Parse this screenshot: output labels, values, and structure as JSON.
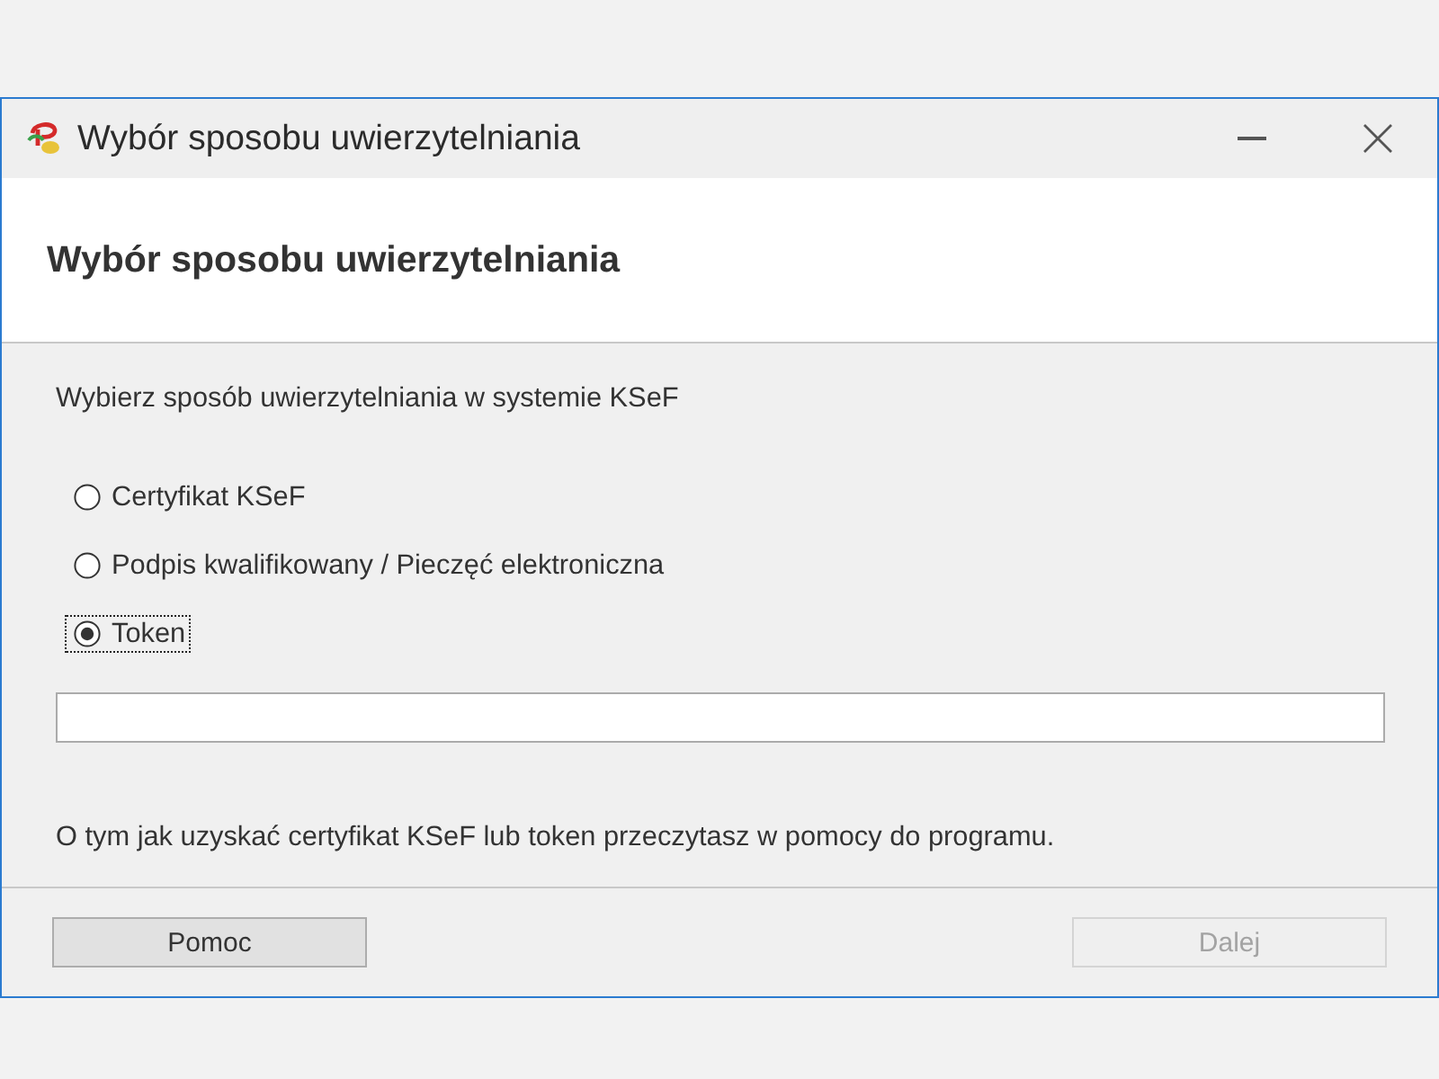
{
  "window": {
    "title": "Wybór sposobu uwierzytelniania"
  },
  "header": {
    "title": "Wybór sposobu uwierzytelniania"
  },
  "instruction": "Wybierz sposób uwierzytelniania w systemie KSeF",
  "options": [
    {
      "label": "Certyfikat KSeF",
      "selected": false,
      "focused": false
    },
    {
      "label": "Podpis kwalifikowany / Pieczęć elektroniczna",
      "selected": false,
      "focused": false
    },
    {
      "label": "Token",
      "selected": true,
      "focused": true
    }
  ],
  "help_text": "O tym jak uzyskać certyfikat KSeF lub token przeczytasz w pomocy do programu.",
  "buttons": [
    {
      "label": "Pomoc",
      "disabled": false
    },
    {
      "label": "Dalej",
      "disabled": true
    }
  ]
}
